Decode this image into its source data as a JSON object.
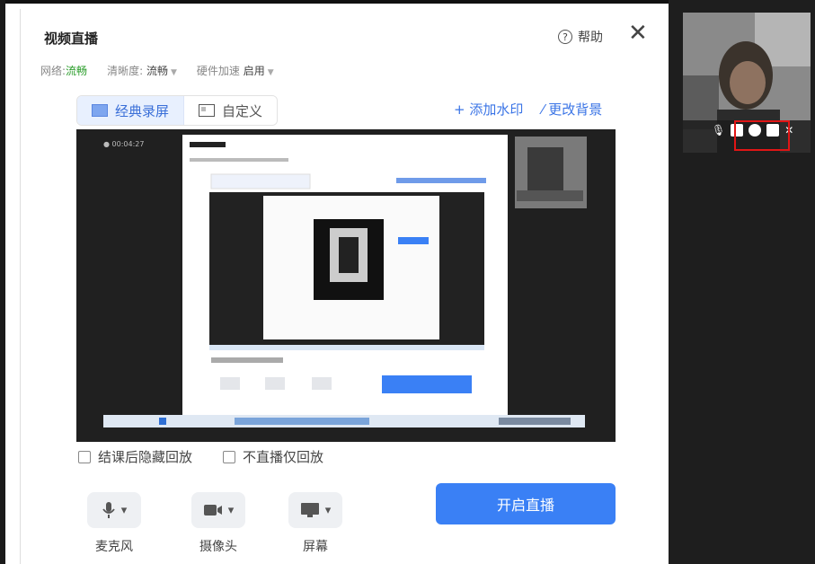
{
  "dialog": {
    "title": "视频直播",
    "help": "帮助",
    "close": "✕"
  },
  "status": {
    "network_label": "网络:",
    "network_value": "流畅",
    "clarity_label": "清晰度:",
    "clarity_value": "流畅",
    "hw_label": "硬件加速",
    "hw_value": "启用"
  },
  "tabs": [
    {
      "label": "经典录屏",
      "active": true
    },
    {
      "label": "自定义",
      "active": false
    }
  ],
  "actions": {
    "add_watermark": "+ 添加水印",
    "change_background": "⁄ 更改背景"
  },
  "preview": {
    "timer": "● 00:04:27"
  },
  "options": {
    "hide_replay": "结课后隐藏回放",
    "replay_only": "不直播仅回放"
  },
  "devices": [
    {
      "label": "麦克风",
      "icon": "microphone-icon"
    },
    {
      "label": "摄像头",
      "icon": "camera-icon"
    },
    {
      "label": "屏幕",
      "icon": "screen-icon"
    }
  ],
  "start_button": "开启直播",
  "colors": {
    "accent": "#3a80f5",
    "highlight": "#e01515",
    "network_ok": "#2a9d2a"
  }
}
